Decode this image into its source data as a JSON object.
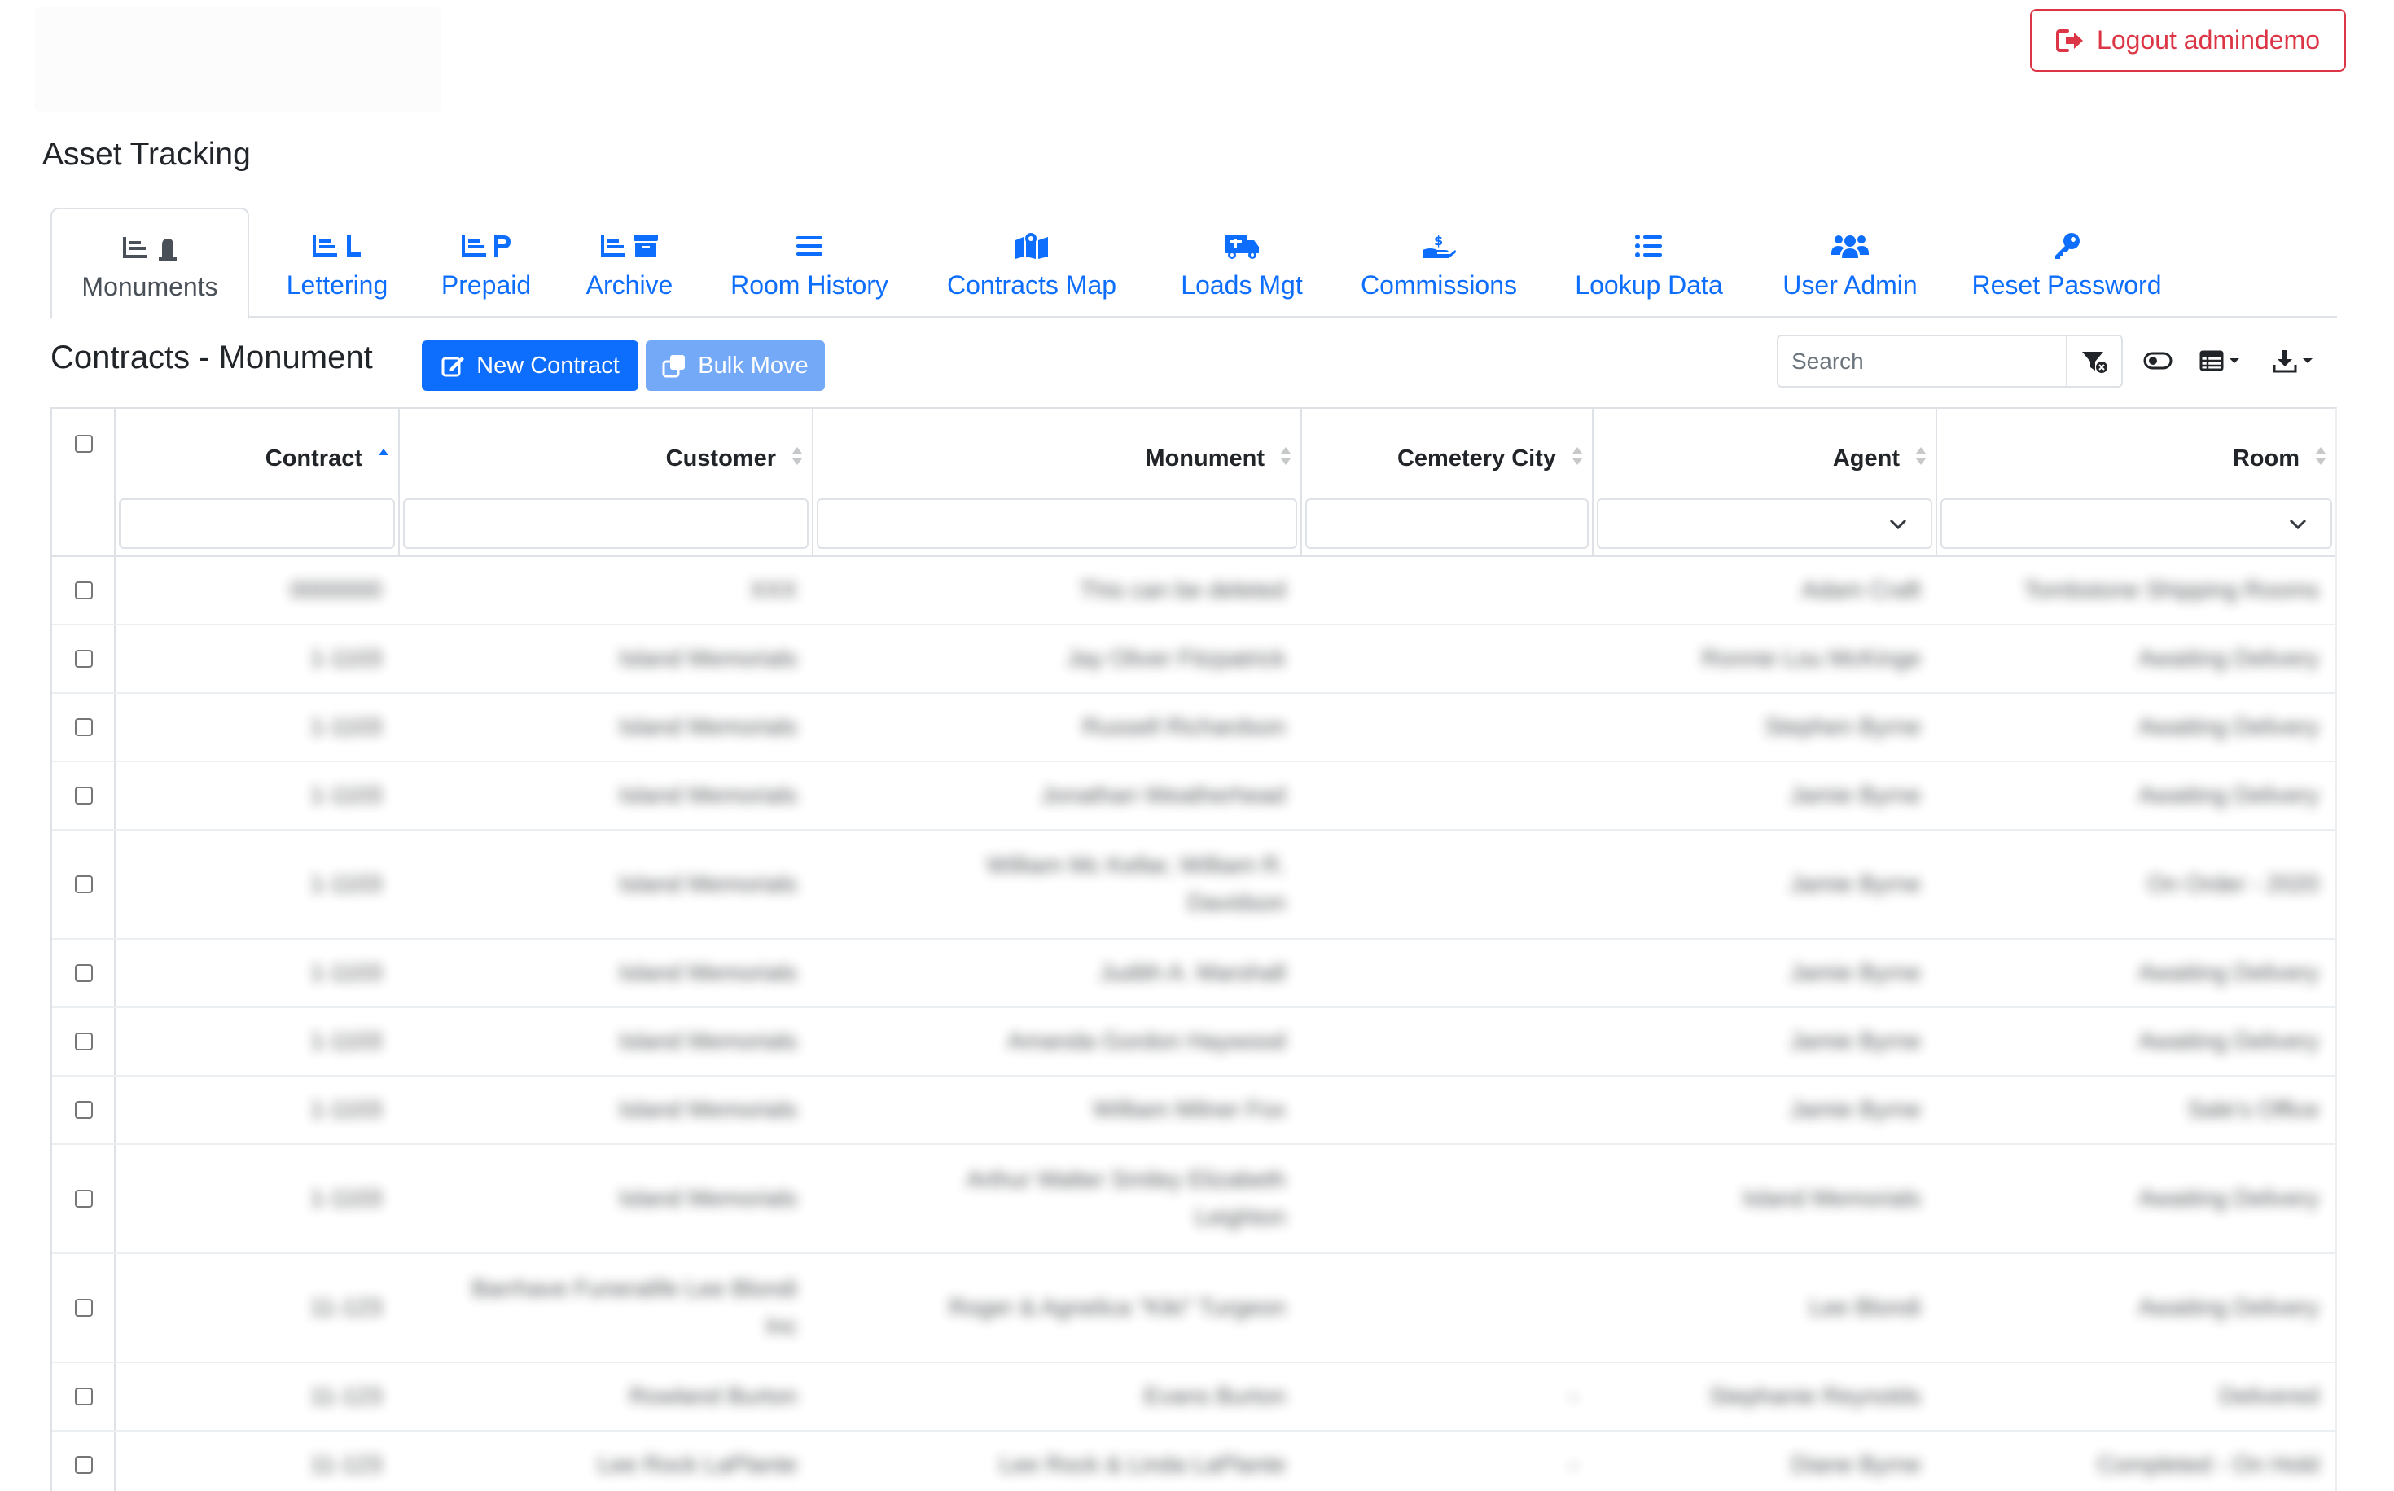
{
  "header": {
    "logout_label": "Logout admindemo",
    "app_title": "Asset Tracking"
  },
  "tabs": [
    {
      "label": "Monuments",
      "icon": "monuments-icon",
      "active": true
    },
    {
      "label": "Lettering",
      "icon": "lettering-icon"
    },
    {
      "label": "Prepaid",
      "icon": "prepaid-icon"
    },
    {
      "label": "Archive",
      "icon": "archive-icon"
    },
    {
      "label": "Room History",
      "icon": "list-icon"
    },
    {
      "label": "Contracts Map",
      "icon": "map-icon"
    },
    {
      "label": "Loads Mgt",
      "icon": "truck-icon"
    },
    {
      "label": "Commissions",
      "icon": "hand-dollar-icon"
    },
    {
      "label": "Lookup Data",
      "icon": "list-ul-icon"
    },
    {
      "label": "User Admin",
      "icon": "users-icon"
    },
    {
      "label": "Reset Password",
      "icon": "key-icon"
    }
  ],
  "toolbar": {
    "section_title": "Contracts - Monument",
    "new_contract_label": "New Contract",
    "bulk_move_label": "Bulk Move",
    "search_placeholder": "Search"
  },
  "table": {
    "columns": [
      {
        "key": "contract",
        "label": "Contract",
        "sorted": "asc"
      },
      {
        "key": "customer",
        "label": "Customer"
      },
      {
        "key": "monument",
        "label": "Monument"
      },
      {
        "key": "cemetery_city",
        "label": "Cemetery City"
      },
      {
        "key": "agent",
        "label": "Agent",
        "filter": "select"
      },
      {
        "key": "room",
        "label": "Room",
        "filter": "select"
      }
    ],
    "rows": [
      {
        "contract": "0000000",
        "customer": "XXX",
        "monument": "This can be deleted",
        "cemetery_city": "",
        "agent": "Adam Craft",
        "room": "Tombstone Shipping Rooms"
      },
      {
        "contract": "1-1103",
        "customer": "Island Memorials",
        "monument": "Jay Oliver Fitzpatrick",
        "cemetery_city": "",
        "agent": "Ronnie Lou McKinge",
        "room": "Awaiting Delivery"
      },
      {
        "contract": "1-1103",
        "customer": "Island Memorials",
        "monument": "Russell Richardson",
        "cemetery_city": "",
        "agent": "Stephen Byrne",
        "room": "Awaiting Delivery"
      },
      {
        "contract": "1-1103",
        "customer": "Island Memorials",
        "monument": "Jonathan Weatherhead",
        "cemetery_city": "",
        "agent": "Jamie Byrne",
        "room": "Awaiting Delivery"
      },
      {
        "contract": "1-1103",
        "customer": "Island Memorials",
        "monument": "William Mc Kellar, William R. Davidson",
        "cemetery_city": "",
        "agent": "Jamie Byrne",
        "room": "On Order - 2020"
      },
      {
        "contract": "1-1103",
        "customer": "Island Memorials",
        "monument": "Judith A. Marshall",
        "cemetery_city": "",
        "agent": "Jamie Byrne",
        "room": "Awaiting Delivery"
      },
      {
        "contract": "1-1103",
        "customer": "Island Memorials",
        "monument": "Amanda Gordon Haywood",
        "cemetery_city": "",
        "agent": "Jamie Byrne",
        "room": "Awaiting Delivery"
      },
      {
        "contract": "1-1103",
        "customer": "Island Memorials",
        "monument": "William Milner Fox",
        "cemetery_city": "",
        "agent": "Jamie Byrne",
        "room": "Sale's Office"
      },
      {
        "contract": "1-1103",
        "customer": "Island Memorials",
        "monument": "Arthur Walter Smiley Elizabeth Leighton",
        "cemetery_city": "",
        "agent": "Island Memorials",
        "room": "Awaiting Delivery"
      },
      {
        "contract": "11-123",
        "customer": "Barrhave Funeralife Lee Blondi Inc",
        "monument": "Roger & Agnelica \"Kiki\" Turgeon",
        "cemetery_city": "",
        "agent": "Lee Blondi",
        "room": "Awaiting Delivery"
      },
      {
        "contract": "11-123",
        "customer": "Rowland Burton",
        "monument": "Evans Burton",
        "cemetery_city": "-",
        "agent": "Stephanie Reynolds",
        "room": "Delivered"
      },
      {
        "contract": "11-123",
        "customer": "Lee Rock LaPlante",
        "monument": "Lee Rock & Linda LaPlante",
        "cemetery_city": "-",
        "agent": "Diane Byrne",
        "room": "Completed - On Hold"
      }
    ]
  }
}
